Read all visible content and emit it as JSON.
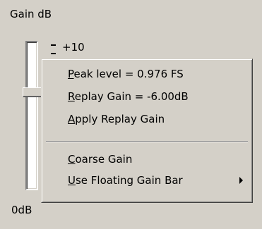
{
  "gain_group": {
    "label": "Gain dB",
    "bottom_label": "0dB",
    "scale_top_label": "+10"
  },
  "context_menu": {
    "items": [
      {
        "prefix": "",
        "mnemonic": "P",
        "rest": "eak level = 0.976 FS"
      },
      {
        "prefix": "",
        "mnemonic": "R",
        "rest": "eplay Gain = -6.00dB"
      },
      {
        "prefix": "",
        "mnemonic": "A",
        "rest": "pply Replay Gain"
      },
      {
        "prefix": "",
        "mnemonic": "C",
        "rest": "oarse Gain"
      },
      {
        "prefix": "",
        "mnemonic": "U",
        "rest": "se Floating Gain Bar"
      }
    ],
    "submenu_arrow_icon": "triangle-right-icon"
  }
}
